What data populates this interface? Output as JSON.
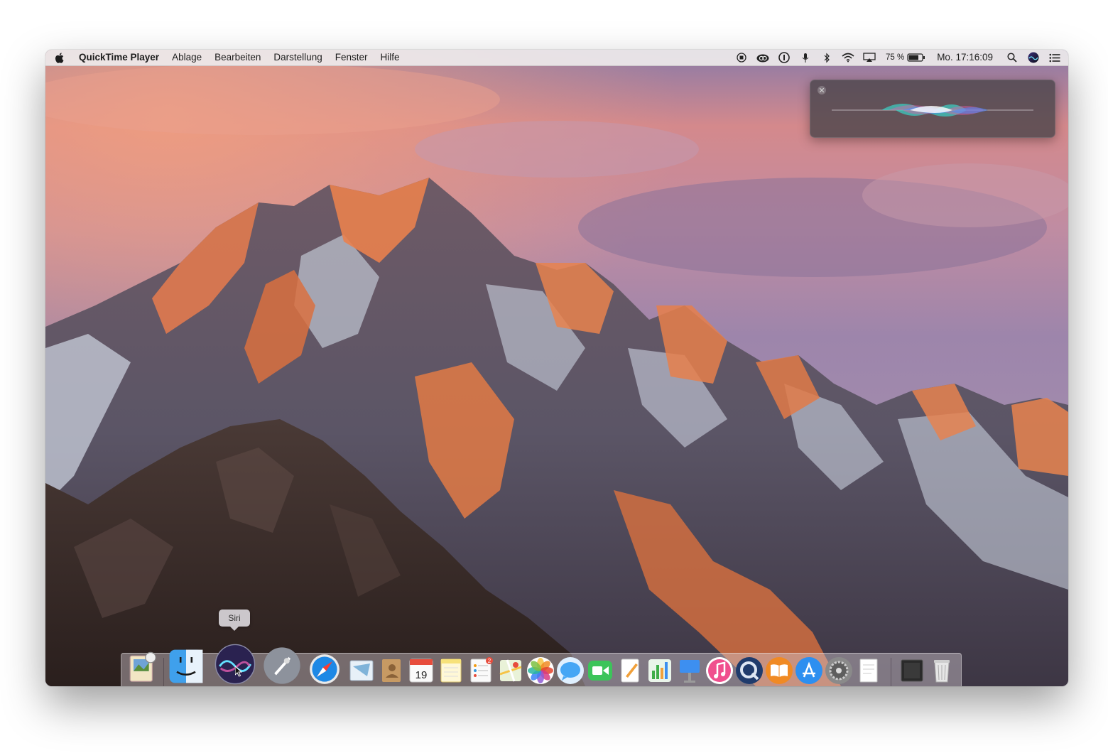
{
  "menubar": {
    "app_name": "QuickTime Player",
    "menus": [
      "Ablage",
      "Bearbeiten",
      "Darstellung",
      "Fenster",
      "Hilfe"
    ],
    "status_icons": [
      "record-icon",
      "creative-cloud-icon",
      "1password-icon",
      "microphone-icon",
      "bluetooth-icon",
      "wifi-icon",
      "airplay-icon"
    ],
    "battery_percent": "75 %",
    "battery_level": 0.75,
    "clock": "Mo. 17:16:09"
  },
  "siri_panel": {
    "state": "listening"
  },
  "tooltip": {
    "label": "Siri"
  },
  "dock": {
    "items": [
      {
        "name": "preview-icon",
        "color": "#e9d9b0"
      },
      {
        "name": "finder-icon",
        "color": "#3fa0ec"
      },
      {
        "name": "siri-icon",
        "color": "#5a4fa8"
      },
      {
        "name": "launchpad-icon",
        "color": "#8a8f99"
      },
      {
        "name": "safari-icon",
        "color": "#1e88e5"
      },
      {
        "name": "mail-icon",
        "color": "#7fb3d9"
      },
      {
        "name": "contacts-icon",
        "color": "#b08a5a"
      },
      {
        "name": "calendar-icon",
        "color": "#f2f2f2",
        "text": "19"
      },
      {
        "name": "notes-icon",
        "color": "#f7e27a"
      },
      {
        "name": "reminders-icon",
        "color": "#f2f2f2",
        "badge": "2"
      },
      {
        "name": "maps-icon",
        "color": "#a8d08d"
      },
      {
        "name": "photos-icon",
        "color": "#f4f4f4"
      },
      {
        "name": "messages-icon",
        "color": "#45a6f5"
      },
      {
        "name": "facetime-icon",
        "color": "#3cc45a"
      },
      {
        "name": "pages-icon",
        "color": "#f1a03a"
      },
      {
        "name": "numbers-icon",
        "color": "#3fae49"
      },
      {
        "name": "keynote-icon",
        "color": "#3d8ff0"
      },
      {
        "name": "itunes-icon",
        "color": "#f04f8e"
      },
      {
        "name": "quicktime-icon",
        "color": "#1f3b6c"
      },
      {
        "name": "ibooks-icon",
        "color": "#f08a24"
      },
      {
        "name": "app-store-icon",
        "color": "#2d8ff0"
      },
      {
        "name": "system-preferences-icon",
        "color": "#7a7a7a"
      },
      {
        "name": "textedit-icon",
        "color": "#eeeeee"
      },
      {
        "name": "stack-folder-icon",
        "color": "#2a2a2a"
      },
      {
        "name": "trash-icon",
        "color": "#d8d8d8"
      }
    ]
  }
}
